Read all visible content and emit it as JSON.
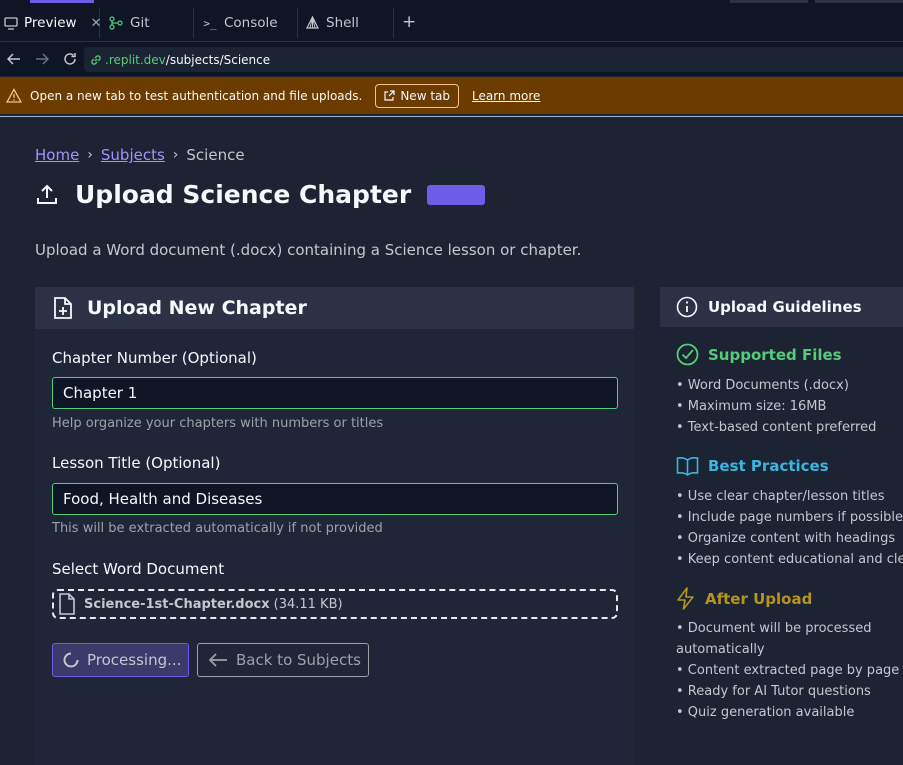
{
  "ide": {
    "tabs": [
      {
        "label": "Preview",
        "icon": "monitor-icon",
        "active": true
      },
      {
        "label": "Git",
        "icon": "git-icon",
        "active": false
      },
      {
        "label": "Console",
        "icon": "terminal-icon",
        "active": false
      },
      {
        "label": "Shell",
        "icon": "shell-icon",
        "active": false
      }
    ],
    "url_host": ".replit.dev",
    "url_path": "/subjects/Science",
    "warning_text": "Open a new tab to test authentication and file uploads.",
    "new_tab_label": "New tab",
    "learn_more_label": "Learn more"
  },
  "breadcrumb": {
    "home": "Home",
    "subjects": "Subjects",
    "current": "Science"
  },
  "page": {
    "title": "Upload Science Chapter",
    "subtitle": "Upload a Word document (.docx) containing a Science lesson or chapter."
  },
  "upload_card": {
    "title": "Upload New Chapter",
    "chapter_label": "Chapter Number (Optional)",
    "chapter_value": "Chapter 1",
    "chapter_help": "Help organize your chapters with numbers or titles",
    "lesson_label": "Lesson Title (Optional)",
    "lesson_value": "Food, Health and Diseases",
    "lesson_help": "This will be extracted automatically if not provided",
    "file_label": "Select Word Document",
    "file_name": "Science-1st-Chapter.docx",
    "file_size": "(34.11 KB)",
    "processing_label": "Processing...",
    "back_label": "Back to Subjects"
  },
  "guidelines": {
    "title": "Upload Guidelines",
    "supported": {
      "title": "Supported Files",
      "color": "#56cc7a",
      "items": [
        "• Word Documents (.docx)",
        "• Maximum size: 16MB",
        "• Text-based content preferred"
      ]
    },
    "best": {
      "title": "Best Practices",
      "color": "#3bb5e0",
      "items": [
        "• Use clear chapter/lesson titles",
        "• Include page numbers if possible",
        "• Organize content with headings",
        "• Keep content educational and clear"
      ]
    },
    "after": {
      "title": "After Upload",
      "color": "#b59520",
      "items": [
        "• Document will be processed automatically",
        "• Content extracted page by page",
        "• Ready for AI Tutor questions",
        "• Quiz generation available"
      ]
    }
  },
  "colors": {
    "accent": "#6c5ce7",
    "link": "#a394ff",
    "warning_bg": "#6b3b00",
    "input_border": "#56cc7a"
  }
}
